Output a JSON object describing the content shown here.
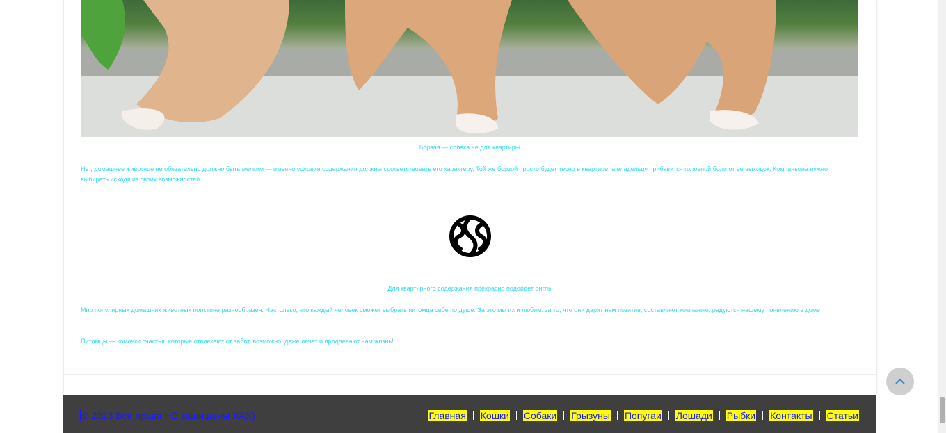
{
  "article": {
    "image_caption": "Борзая — собака не для квартиры",
    "paragraph_1": "Нет, домашнее животное не обязательно должно быть мелким — именно условия содержания должны соответствовать его характеру. Той же борзой просто будет тесно в квартире, а владельцу прибавится головной боли от ее выходок. Компаньона нужно выбирать исходя из своих возможностей.",
    "logo_caption": "Для квартирного содержания прекрасно подойдет бигль",
    "paragraph_2": "Мир популярных домашних животных поистине разнообразен. Настолько, что каждый человек сможет выбрать питомца себе по душе. За это мы их и любим: за то, что они дарят нам позитив, составляют компанию, радуются нашему появлению в доме.",
    "paragraph_3": "Питомцы — комочки счастья, которые отвлекают от забот, возможно, даже лечат и продлевают нам жизнь!"
  },
  "footer": {
    "copyright": "© 2023 Все права НЕ защищены XAX)",
    "nav": [
      "Главная",
      "Кошки",
      "Собаки",
      "Грызуны",
      "Попугаи",
      "Лошади",
      "Рыбки",
      "Контакты",
      "Статьи"
    ]
  },
  "icons": {
    "scroll_top": "chevron-up-icon",
    "logo": "brain-logo-icon"
  },
  "colors": {
    "text_cyan": "#34d8f0",
    "footer_bg": "#3f3f3f",
    "link_blue": "#1a1aff",
    "link_highlight": "#ffff00"
  }
}
